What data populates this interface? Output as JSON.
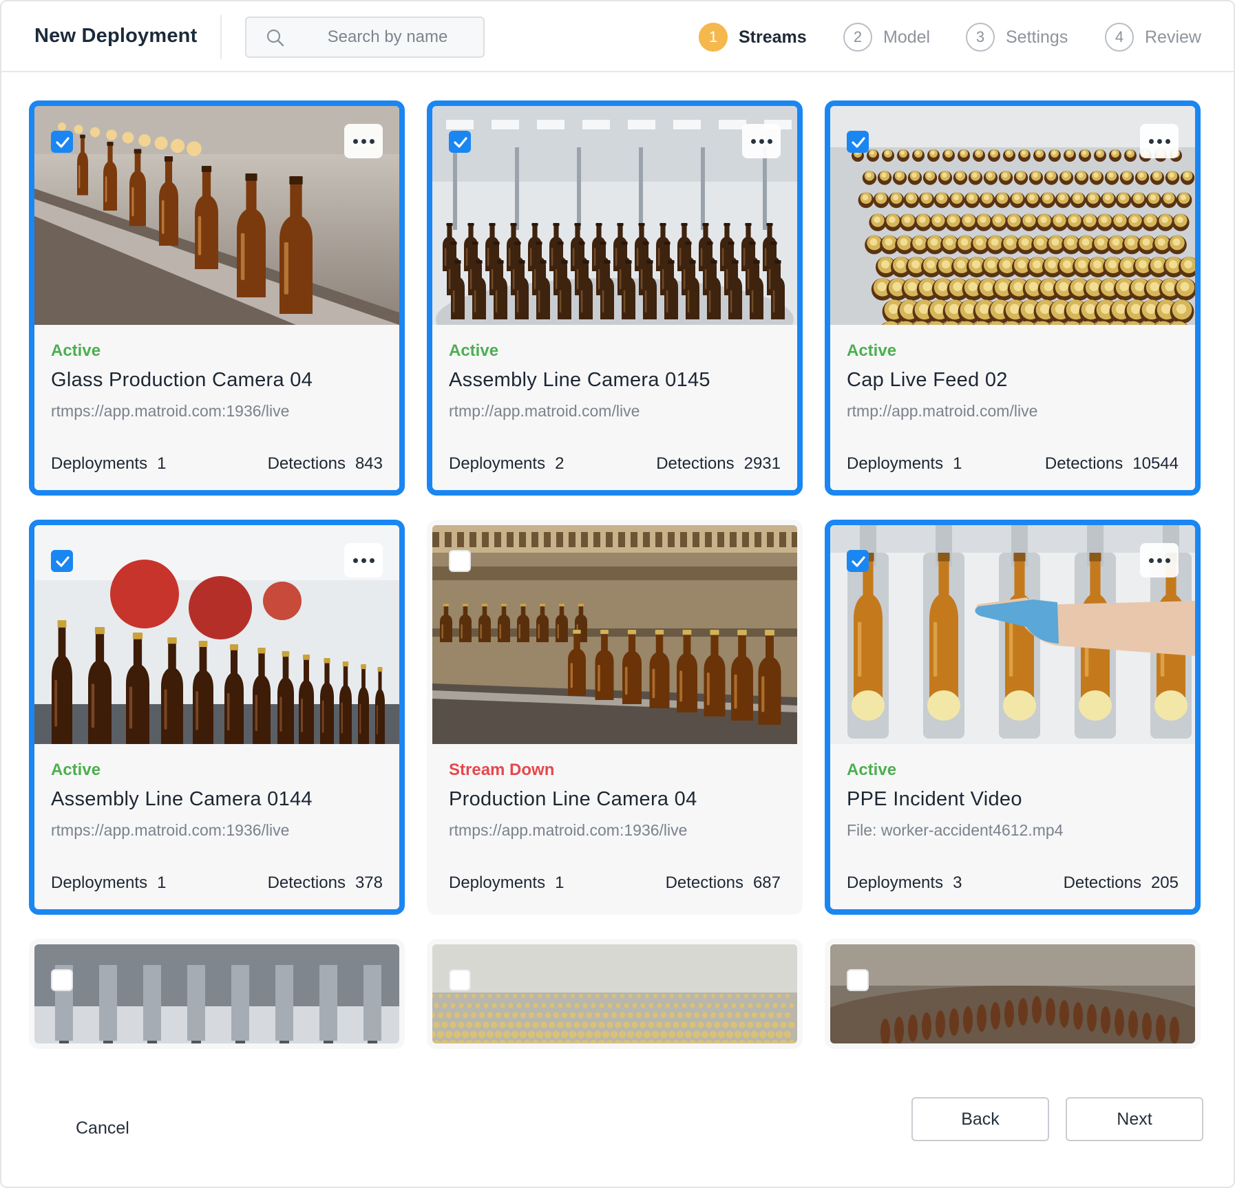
{
  "header": {
    "title": "New Deployment",
    "search": {
      "placeholder": "Search by name",
      "value": ""
    },
    "steps": [
      {
        "num": "1",
        "label": "Streams",
        "active": true
      },
      {
        "num": "2",
        "label": "Model",
        "active": false
      },
      {
        "num": "3",
        "label": "Settings",
        "active": false
      },
      {
        "num": "4",
        "label": "Review",
        "active": false
      }
    ]
  },
  "stat_labels": {
    "deployments": "Deployments",
    "detections": "Detections"
  },
  "streams": [
    {
      "selected": true,
      "status": "Active",
      "name": "Glass Production Camera 04",
      "source": "rtmps://app.matroid.com:1936/live",
      "deployments": "1",
      "detections": "843",
      "thumb": "bottles-conveyor-closeup"
    },
    {
      "selected": true,
      "status": "Active",
      "name": "Assembly Line Camera 0145",
      "source": "rtmp://app.matroid.com/live",
      "deployments": "2",
      "detections": "2931",
      "thumb": "bottles-carousel-factory"
    },
    {
      "selected": true,
      "status": "Active",
      "name": "Cap Live Feed 02",
      "source": "rtmp://app.matroid.com/live",
      "deployments": "1",
      "detections": "10544",
      "thumb": "bottle-caps-rows"
    },
    {
      "selected": true,
      "status": "Active",
      "name": "Assembly Line Camera 0144",
      "source": "rtmps://app.matroid.com:1936/live",
      "deployments": "1",
      "detections": "378",
      "thumb": "capped-bottles-red-machines"
    },
    {
      "selected": false,
      "status": "Stream Down",
      "name": "Production Line Camera 04",
      "source": "rtmps://app.matroid.com:1936/live",
      "deployments": "1",
      "detections": "687",
      "thumb": "bottles-on-rail"
    },
    {
      "selected": true,
      "status": "Active",
      "name": "PPE Incident Video",
      "source": "File: worker-accident4612.mp4",
      "deployments": "3",
      "detections": "205",
      "thumb": "gloved-hand-bottles"
    },
    {
      "selected": false,
      "thumb": "filling-machine"
    },
    {
      "selected": false,
      "thumb": "bottle-field"
    },
    {
      "selected": false,
      "thumb": "blurred-bottle-line"
    }
  ],
  "footer": {
    "cancel": "Cancel",
    "back": "Back",
    "next": "Next"
  },
  "colors": {
    "accent": "#1a86f2",
    "active_status": "#4caf50",
    "down_status": "#e5484d",
    "step_active": "#f5b84c"
  }
}
